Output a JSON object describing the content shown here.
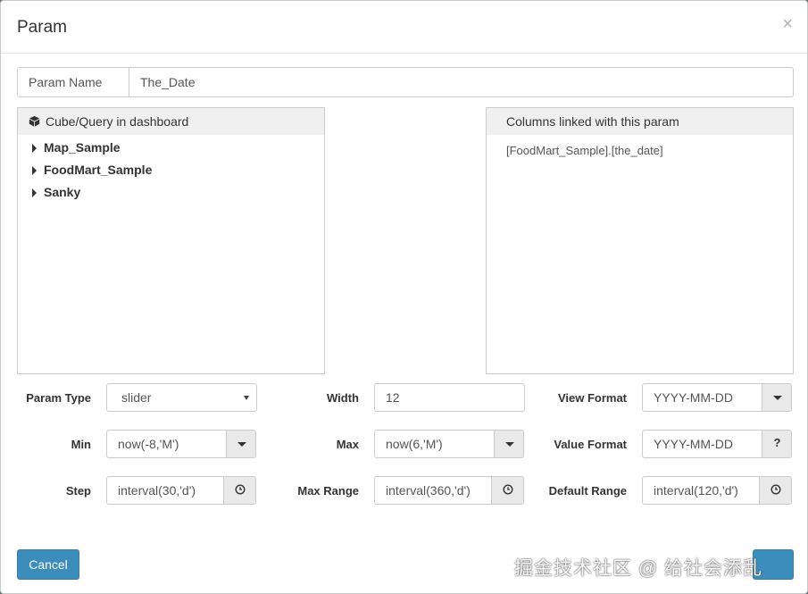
{
  "dialog": {
    "title": "Param",
    "close_glyph": "×"
  },
  "param_name": {
    "label": "Param Name",
    "value": "The_Date"
  },
  "left_panel": {
    "icon": "cube-icon",
    "title": "Cube/Query in dashboard",
    "items": [
      "Map_Sample",
      "FoodMart_Sample",
      "Sanky"
    ]
  },
  "right_panel": {
    "title": "Columns linked with this param",
    "columns": [
      "[FoodMart_Sample].[the_date]"
    ]
  },
  "form": {
    "param_type": {
      "label": "Param Type",
      "value": "slider"
    },
    "width": {
      "label": "Width",
      "value": "12"
    },
    "view_format": {
      "label": "View Format",
      "value": "YYYY-MM-DD"
    },
    "min": {
      "label": "Min",
      "value": "now(-8,'M')"
    },
    "max": {
      "label": "Max",
      "value": "now(6,'M')"
    },
    "value_format": {
      "label": "Value Format",
      "value": "YYYY-MM-DD",
      "help_glyph": "?"
    },
    "step": {
      "label": "Step",
      "value": "interval(30,'d')"
    },
    "max_range": {
      "label": "Max Range",
      "value": "interval(360,'d')"
    },
    "default_range": {
      "label": "Default Range",
      "value": "interval(120,'d')"
    }
  },
  "footer": {
    "cancel_label": "Cancel",
    "ok_label": ""
  },
  "watermark": "掘金技术社区 @ 给社会添乱",
  "colors": {
    "primary": "#3c8dbc",
    "panel_header": "#f0f0f0",
    "addon_button": "#e9e9e9"
  }
}
